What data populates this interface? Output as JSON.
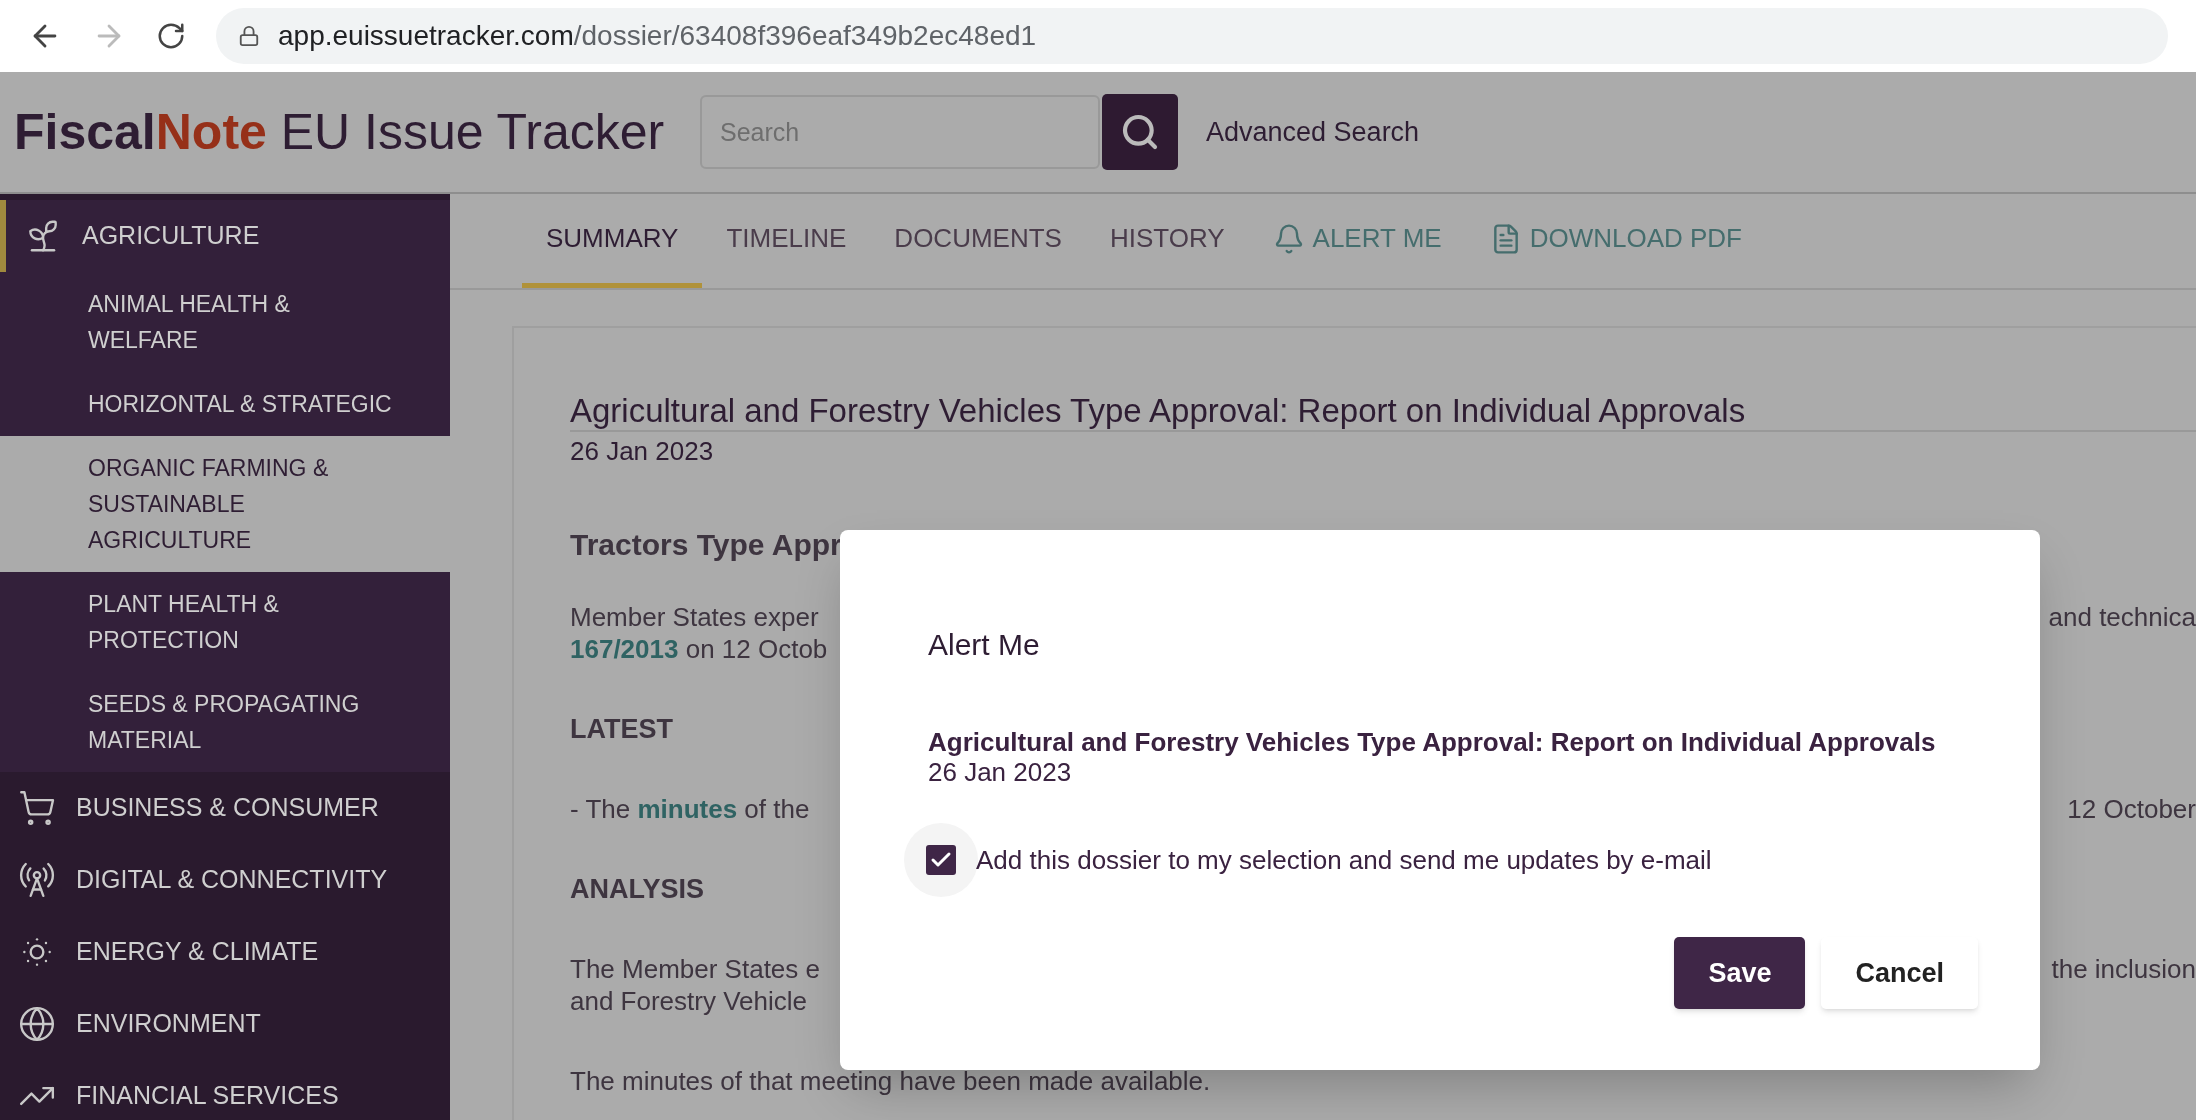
{
  "browser": {
    "url_host": "app.euissuetracker.com",
    "url_path": "/dossier/63408f396eaf349b2ec48ed1"
  },
  "header": {
    "logo_brand_a": "Fiscal",
    "logo_brand_b": "Note",
    "logo_product": "EU Issue Tracker",
    "search": {
      "placeholder": "Search"
    },
    "advanced_search": "Advanced Search"
  },
  "sidebar": {
    "items": [
      {
        "label": "AGRICULTURE",
        "kind": "sprout",
        "selected": true,
        "children": [
          {
            "label": "ANIMAL HEALTH & WELFARE",
            "selected": false
          },
          {
            "label": "HORIZONTAL & STRATEGIC",
            "selected": false
          },
          {
            "label": "ORGANIC FARMING & SUSTAINABLE AGRICULTURE",
            "selected": true
          },
          {
            "label": "PLANT HEALTH & PROTECTION",
            "selected": false
          },
          {
            "label": "SEEDS & PROPAGATING MATERIAL",
            "selected": false
          }
        ]
      },
      {
        "label": "BUSINESS & CONSUMER",
        "kind": "cart",
        "selected": false
      },
      {
        "label": "DIGITAL & CONNECTIVITY",
        "kind": "antenna",
        "selected": false
      },
      {
        "label": "ENERGY & CLIMATE",
        "kind": "sun",
        "selected": false
      },
      {
        "label": "ENVIRONMENT",
        "kind": "globe",
        "selected": false
      },
      {
        "label": "FINANCIAL SERVICES",
        "kind": "chart",
        "selected": false
      }
    ]
  },
  "tabs": [
    {
      "label": "SUMMARY",
      "kind": "text",
      "selected": true
    },
    {
      "label": "TIMELINE",
      "kind": "text",
      "selected": false
    },
    {
      "label": "DOCUMENTS",
      "kind": "text",
      "selected": false
    },
    {
      "label": "HISTORY",
      "kind": "text",
      "selected": false
    },
    {
      "label": "ALERT ME",
      "kind": "bell",
      "selected": false
    },
    {
      "label": "DOWNLOAD PDF",
      "kind": "pdf",
      "selected": false
    }
  ],
  "dossier": {
    "title": "Agricultural and Forestry Vehicles Type Approval: Report on Individual Approvals",
    "date": "26 Jan 2023"
  },
  "content_blocks": [
    {
      "kind": "subheading",
      "lines": [
        {
          "left": "Tractors Type Appr"
        }
      ]
    },
    {
      "kind": "paragraph",
      "lines": [
        {
          "left": "Member States exper",
          "right": "and technica"
        },
        {
          "link": "167/2013",
          "left": " on 12 Octob"
        }
      ]
    },
    {
      "kind": "heading",
      "lines": [
        {
          "left": "LATEST"
        }
      ]
    },
    {
      "kind": "paragraph",
      "lines": [
        {
          "before": "- The ",
          "link": "minutes",
          "left": " of the",
          "right": "12 October"
        }
      ]
    },
    {
      "kind": "heading",
      "lines": [
        {
          "left": "ANALYSIS"
        }
      ]
    },
    {
      "kind": "paragraph",
      "lines": [
        {
          "left": "The Member States e",
          "right": "the inclusion"
        },
        {
          "left": "and Forestry Vehicle"
        }
      ]
    },
    {
      "kind": "paragraph",
      "lines": [
        {
          "left": "The minutes of that meeting have been made available."
        }
      ]
    }
  ],
  "dialog": {
    "title": "Alert Me",
    "dossier_title": "Agricultural and Forestry Vehicles Type Approval: Report on Individual Approvals",
    "dossier_date": "26 Jan 2023",
    "checkbox": {
      "label": "Add this dossier to my selection and send me updates by e-mail",
      "checked": true
    },
    "buttons": [
      {
        "label": "Save",
        "kind": "primary"
      },
      {
        "label": "Cancel",
        "kind": "secondary"
      }
    ]
  }
}
